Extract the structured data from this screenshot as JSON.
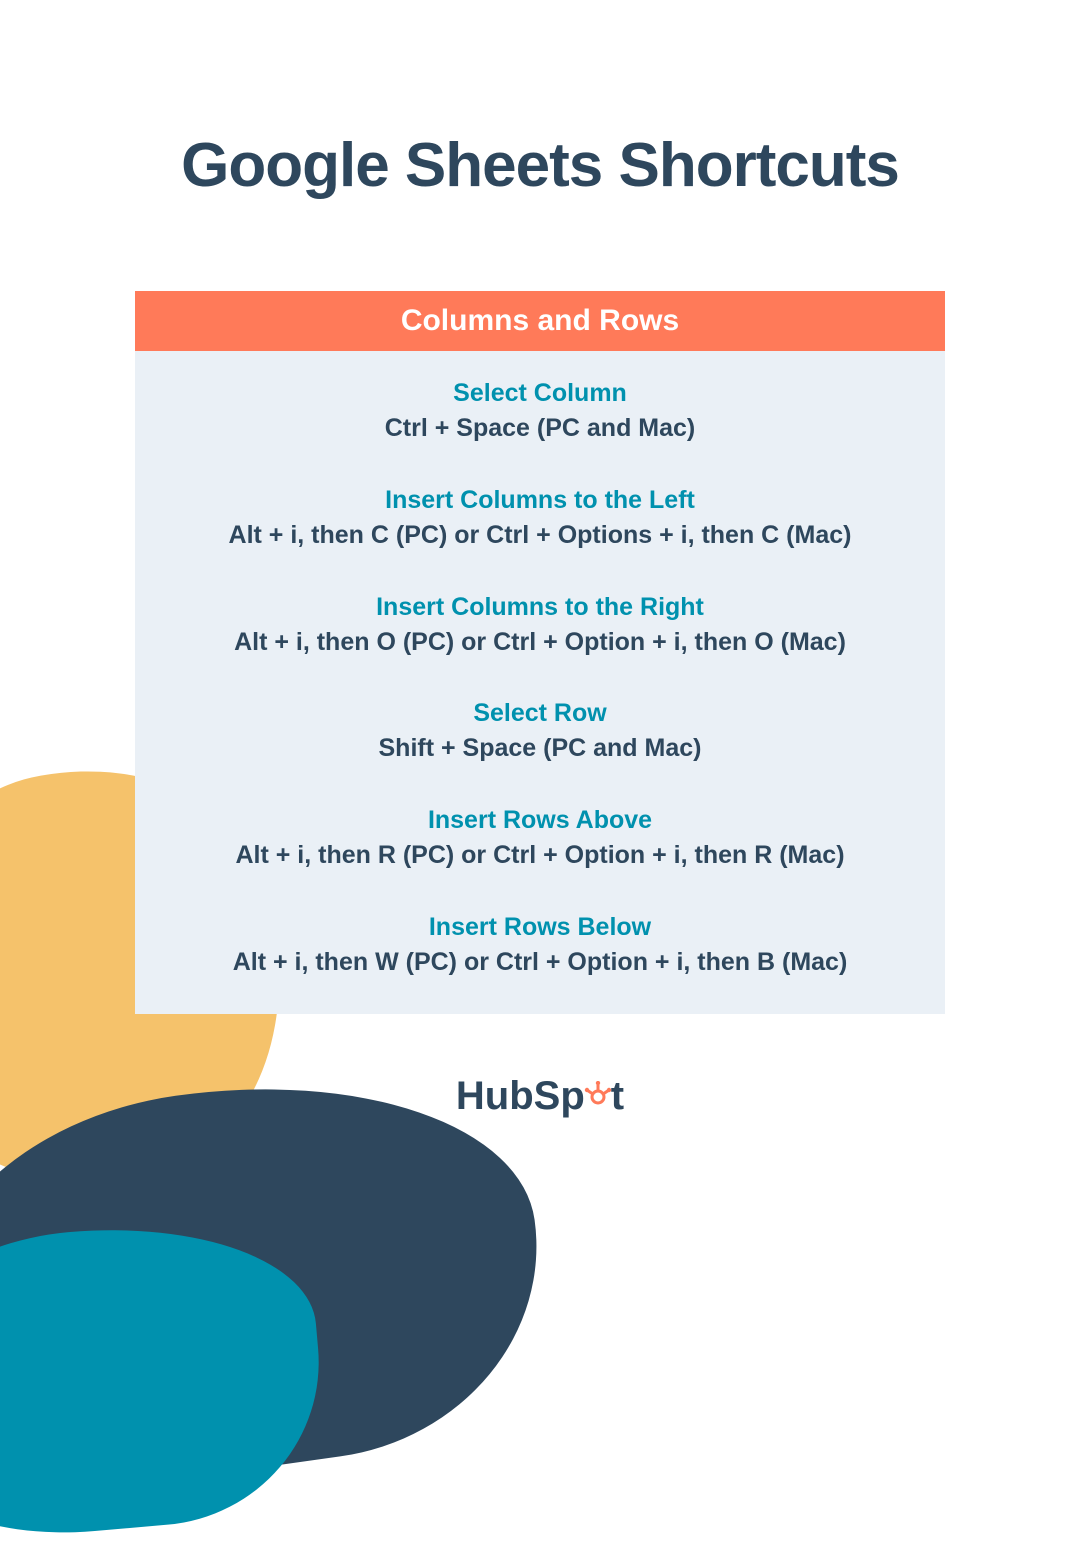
{
  "page": {
    "title": "Google Sheets Shortcuts"
  },
  "card": {
    "header": "Columns and Rows",
    "items": [
      {
        "title": "Select Column",
        "keys": "Ctrl + Space (PC and Mac)"
      },
      {
        "title": "Insert Columns to the Left",
        "keys": "Alt + i, then C (PC) or Ctrl + Options + i, then C (Mac)"
      },
      {
        "title": "Insert Columns to the Right",
        "keys": "Alt + i, then O (PC) or Ctrl + Option + i, then O (Mac)"
      },
      {
        "title": "Select Row",
        "keys": "Shift + Space (PC and Mac)"
      },
      {
        "title": "Insert Rows Above",
        "keys": "Alt + i, then R (PC) or Ctrl + Option + i, then R (Mac)"
      },
      {
        "title": "Insert Rows Below",
        "keys": "Alt + i, then W (PC) or Ctrl + Option + i, then B (Mac)"
      }
    ]
  },
  "brand": {
    "prefix": "HubSp",
    "suffix": "t"
  }
}
